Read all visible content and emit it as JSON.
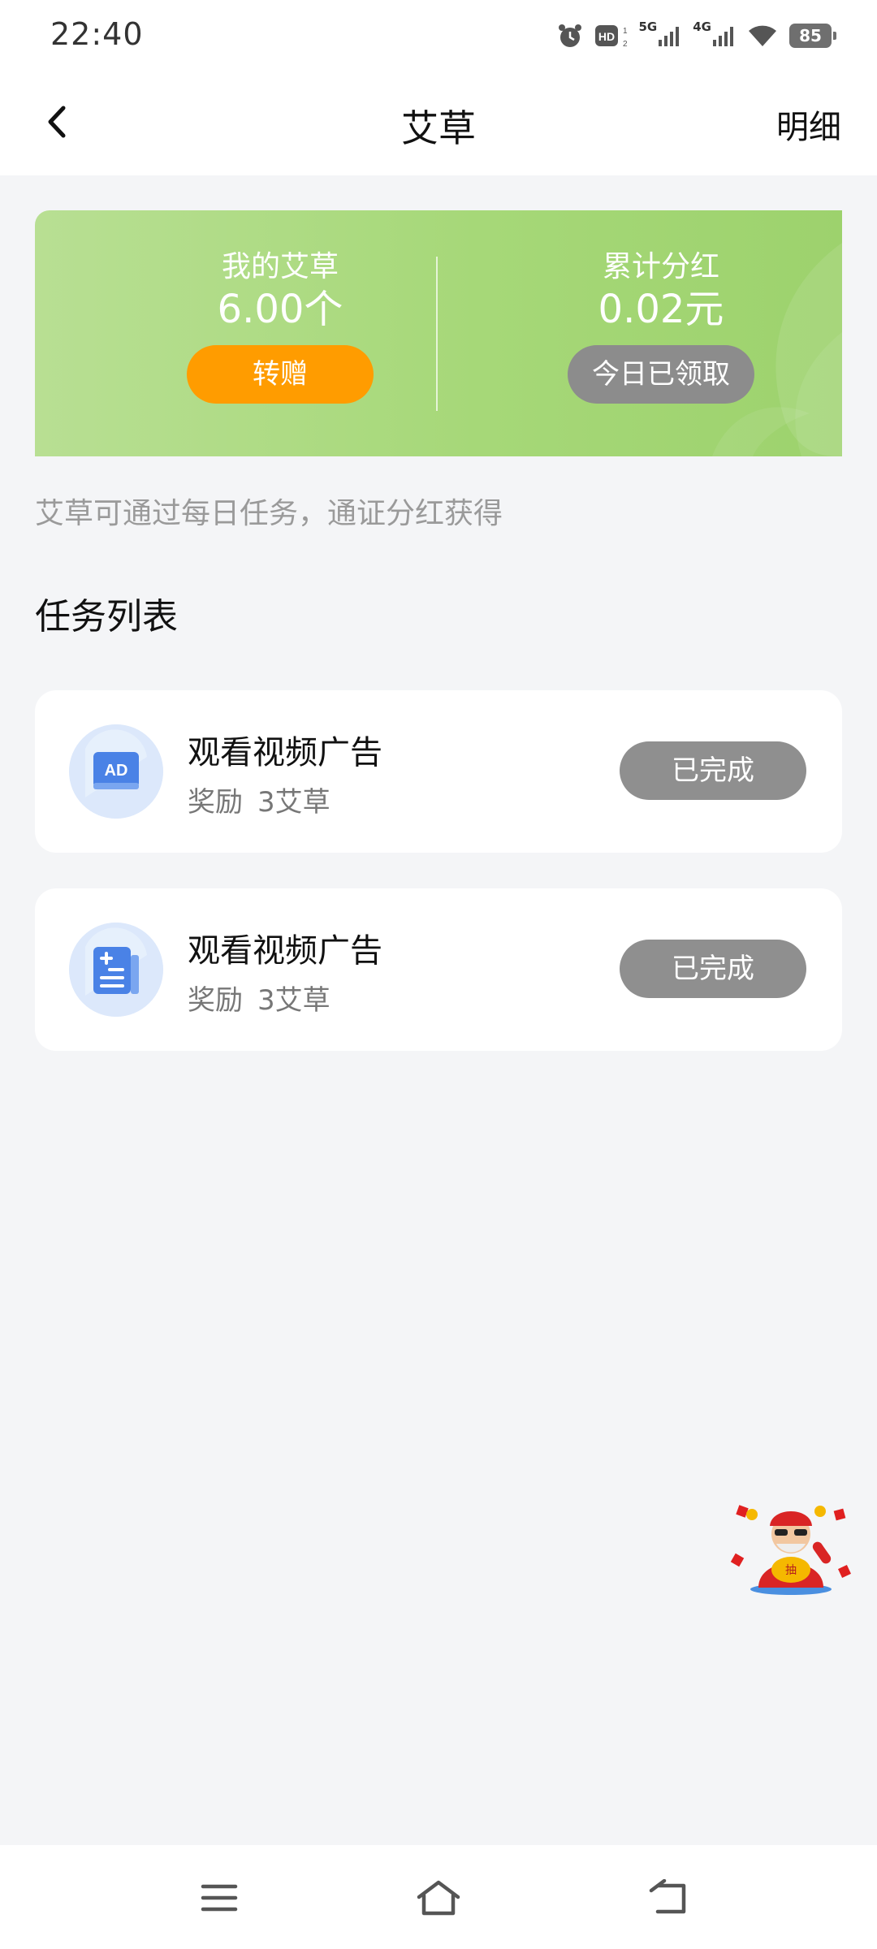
{
  "status_bar": {
    "time": "22:40",
    "hd_label": "HD",
    "signal1_label": "5G",
    "signal2_label": "4G",
    "battery": "85",
    "icons": [
      "alarm-icon",
      "hd-icon",
      "signal-5g-icon",
      "signal-4g-icon",
      "wifi-icon",
      "battery-icon"
    ]
  },
  "header": {
    "title": "艾草",
    "detail_link": "明细",
    "back_icon": "chevron-left-icon"
  },
  "banner": {
    "my_label": "我的艾草",
    "my_value": "6.00个",
    "gift_button": "转赠",
    "dividend_label": "累计分红",
    "dividend_value": "0.02元",
    "claimed_button": "今日已领取",
    "colors": {
      "gradient_start": "#b8df93",
      "gradient_end": "#9dd26d",
      "gift": "#ff9c00",
      "claimed": "#8c8c8c"
    }
  },
  "hint": "艾草可通过每日任务，通证分红获得",
  "section_title": "任务列表",
  "tasks": [
    {
      "icon": "ad-icon",
      "title": "观看视频广告",
      "reward_label": "奖励",
      "reward_value": "3艾草",
      "button": "已完成"
    },
    {
      "icon": "document-plus-icon",
      "title": "观看视频广告",
      "reward_label": "奖励",
      "reward_value": "3艾草",
      "button": "已完成"
    }
  ],
  "floating": {
    "icon": "lucky-mascot-icon"
  },
  "nav_bar": {
    "icons": [
      "menu-icon",
      "home-icon",
      "back-icon"
    ]
  }
}
